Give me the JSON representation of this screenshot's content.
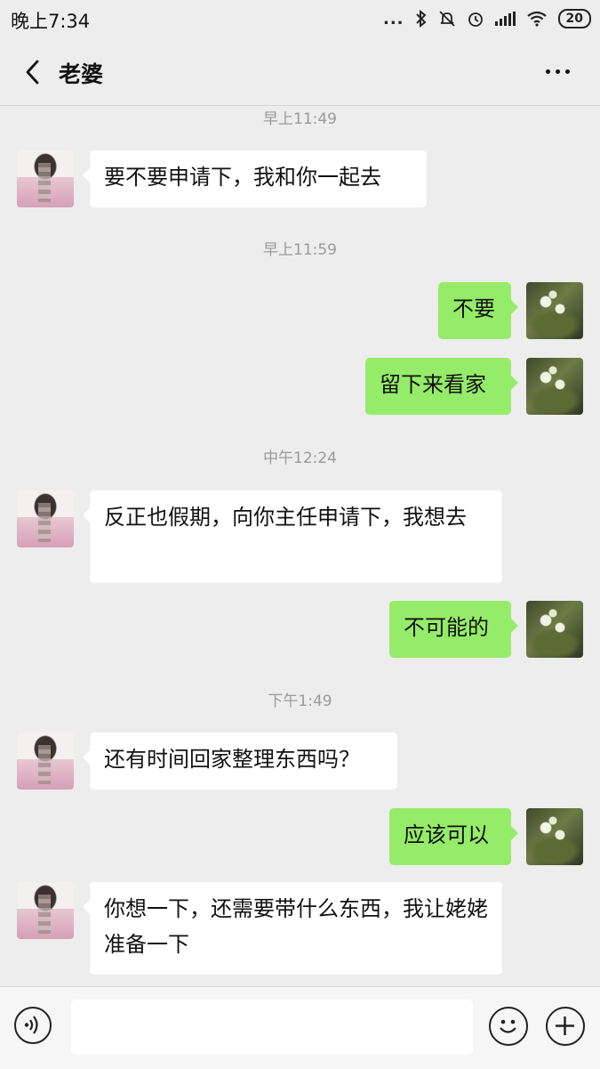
{
  "status_bar": {
    "time": "晚上7:34",
    "signal_dots": "...",
    "icons": [
      "bluetooth-icon",
      "mute-icon",
      "alarm-icon",
      "signal-icon",
      "wifi-icon",
      "battery-icon"
    ],
    "battery": "20"
  },
  "header": {
    "title": "老婆",
    "back_icon": "chevron-left-icon",
    "more_icon": "more-dots-icon"
  },
  "timestamps": [
    "早上11:49",
    "早上11:59",
    "中午12:24",
    "下午1:49"
  ],
  "messages": [
    {
      "from": "her",
      "text": "要不要申请下，我和你一起去"
    },
    {
      "from": "me",
      "text": "不要"
    },
    {
      "from": "me",
      "text": "留下来看家"
    },
    {
      "from": "her",
      "text": "反正也假期，向你主任申请下，我想去"
    },
    {
      "from": "me",
      "text": "不可能的"
    },
    {
      "from": "her",
      "text": "还有时间回家整理东西吗？"
    },
    {
      "from": "me",
      "text": "应该可以"
    },
    {
      "from": "her",
      "text": "你想一下，还需要带什么东西，我让姥姥准备一下"
    }
  ],
  "input_bar": {
    "voice_icon": "voice-icon",
    "text_value": "",
    "emoji_icon": "emoji-icon",
    "plus_icon": "plus-icon"
  },
  "colors": {
    "background": "#ededed",
    "outgoing_bubble": "#95ec69",
    "incoming_bubble": "#ffffff",
    "timestamp": "#9a9a9a"
  }
}
